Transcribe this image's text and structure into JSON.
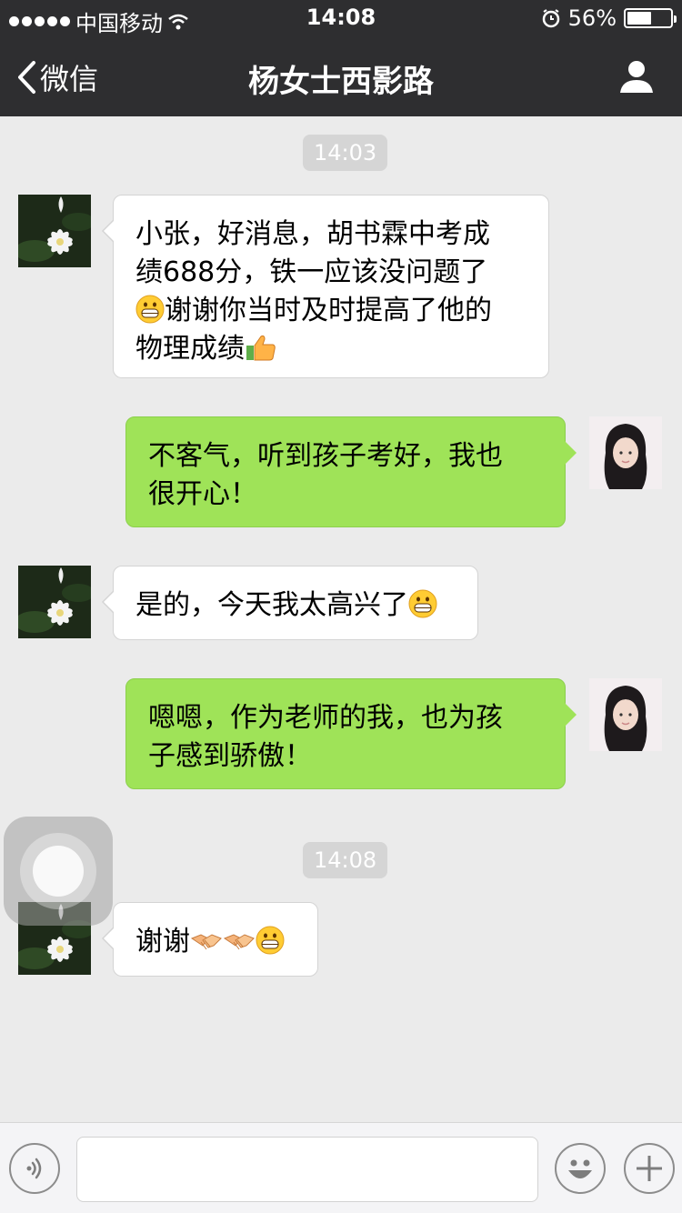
{
  "status_bar": {
    "carrier": "中国移动",
    "time": "14:08",
    "battery": "56%",
    "battery_level": 0.56
  },
  "nav": {
    "back_label": "微信",
    "title": "杨女士西影路"
  },
  "timestamps": [
    "14:03",
    "14:08"
  ],
  "messages": [
    {
      "side": "in",
      "lines": [
        "小张，好消息，胡书霖中考成",
        "绩688分，铁一应该没问题了",
        "谢谢你当时及时提高了他的",
        "物理成绩"
      ]
    },
    {
      "side": "out",
      "lines": [
        "不客气，听到孩子考好，我也",
        "很开心！"
      ]
    },
    {
      "side": "in",
      "lines": [
        "是的，今天我太高兴了"
      ]
    },
    {
      "side": "out",
      "lines": [
        "嗯嗯，作为老师的我，也为孩",
        "子感到骄傲！"
      ]
    },
    {
      "side": "in",
      "lines": [
        "谢谢"
      ]
    }
  ],
  "icons": {
    "grin": "grinning-face-icon",
    "thumbs": "thumbs-up-icon",
    "handshake": "handshake-icon",
    "voice": "voice-icon",
    "emoji": "emoji-icon",
    "add": "plus-icon"
  },
  "colors": {
    "bar": "#2e2e30",
    "background": "#ebebeb",
    "outgoing_bubble": "#9fe358",
    "incoming_bubble": "#ffffff"
  }
}
